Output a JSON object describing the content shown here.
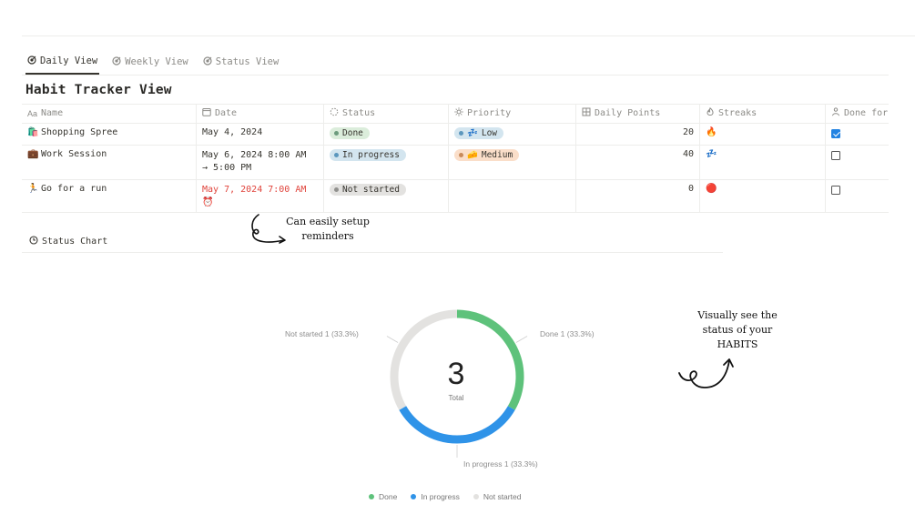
{
  "tabs": [
    {
      "label": "Daily View",
      "icon": "target-icon",
      "active": true
    },
    {
      "label": "Weekly View",
      "icon": "target-icon",
      "active": false
    },
    {
      "label": "Status View",
      "icon": "target-icon",
      "active": false
    }
  ],
  "title": "Habit Tracker View",
  "columns": [
    "Name",
    "Date",
    "Status",
    "Priority",
    "Daily Points",
    "Streaks",
    "Done for"
  ],
  "rows": [
    {
      "icon": "🛍️",
      "name": "Shopping Spree",
      "date": "May 4, 2024",
      "date2": "",
      "status": "Done",
      "priority": "Low",
      "priority_icon": "💤",
      "points": "20",
      "streak": "🔥",
      "done": true
    },
    {
      "icon": "💼",
      "name": "Work Session",
      "date": "May 6, 2024 8:00 AM",
      "date2": "→ 5:00 PM",
      "status": "In progress",
      "priority": "Medium",
      "priority_icon": "🧀",
      "points": "40",
      "streak": "💤",
      "done": false
    },
    {
      "icon": "🏃",
      "name": "Go for a run",
      "date": "May 7, 2024 7:00 AM",
      "date2": "⏰",
      "status": "Not started",
      "priority": "",
      "priority_icon": "",
      "points": "0",
      "streak": "🔴",
      "done": false
    }
  ],
  "chart_tab": "Status Chart",
  "notes": {
    "reminders_line1": "Can easily setup",
    "reminders_line2": "reminders",
    "habits_line1": "Visually see the",
    "habits_line2": "status of your",
    "habits_line3": "HABITS"
  },
  "chart_data": {
    "type": "pie",
    "donut": true,
    "center_value": "3",
    "center_label": "Total",
    "slices": [
      {
        "name": "Done",
        "value": 1,
        "percent": 33.3,
        "color": "#5ec27b",
        "label": "Done 1 (33.3%)"
      },
      {
        "name": "In progress",
        "value": 1,
        "percent": 33.3,
        "color": "#2f93e8",
        "label": "In progress 1 (33.3%)"
      },
      {
        "name": "Not started",
        "value": 1,
        "percent": 33.3,
        "color": "#e3e2e0",
        "label": "Not started 1 (33.3%)"
      }
    ],
    "legend_position": "bottom"
  },
  "colors": {
    "done_bg": "#dbeddb",
    "done_dot": "#6c9b7d",
    "progress_bg": "#d3e5ef",
    "progress_dot": "#5b97bd",
    "notstarted_bg": "#e3e2e0",
    "notstarted_dot": "#91918e",
    "low_bg": "#d3e5ef",
    "medium_bg": "#fadec9",
    "medium_dot": "#c98a5a"
  }
}
